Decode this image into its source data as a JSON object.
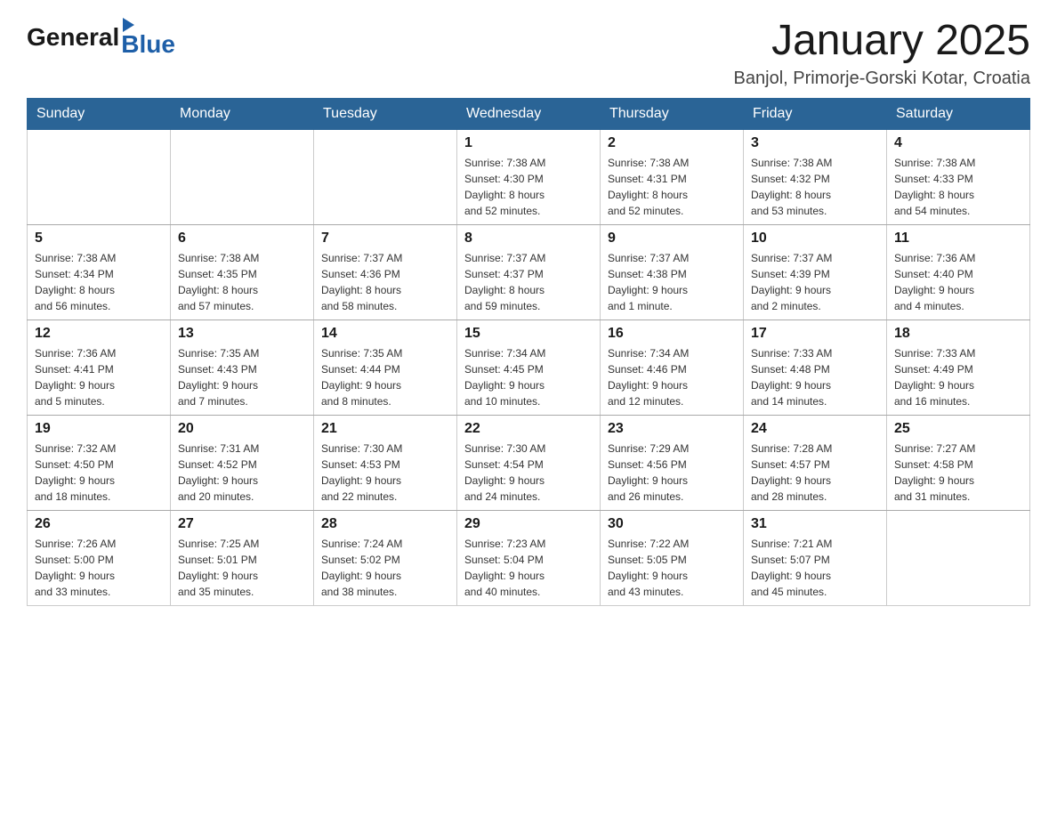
{
  "header": {
    "logo_general": "General",
    "logo_blue": "Blue",
    "title": "January 2025",
    "location": "Banjol, Primorje-Gorski Kotar, Croatia"
  },
  "weekdays": [
    "Sunday",
    "Monday",
    "Tuesday",
    "Wednesday",
    "Thursday",
    "Friday",
    "Saturday"
  ],
  "weeks": [
    [
      {
        "day": "",
        "info": ""
      },
      {
        "day": "",
        "info": ""
      },
      {
        "day": "",
        "info": ""
      },
      {
        "day": "1",
        "info": "Sunrise: 7:38 AM\nSunset: 4:30 PM\nDaylight: 8 hours\nand 52 minutes."
      },
      {
        "day": "2",
        "info": "Sunrise: 7:38 AM\nSunset: 4:31 PM\nDaylight: 8 hours\nand 52 minutes."
      },
      {
        "day": "3",
        "info": "Sunrise: 7:38 AM\nSunset: 4:32 PM\nDaylight: 8 hours\nand 53 minutes."
      },
      {
        "day": "4",
        "info": "Sunrise: 7:38 AM\nSunset: 4:33 PM\nDaylight: 8 hours\nand 54 minutes."
      }
    ],
    [
      {
        "day": "5",
        "info": "Sunrise: 7:38 AM\nSunset: 4:34 PM\nDaylight: 8 hours\nand 56 minutes."
      },
      {
        "day": "6",
        "info": "Sunrise: 7:38 AM\nSunset: 4:35 PM\nDaylight: 8 hours\nand 57 minutes."
      },
      {
        "day": "7",
        "info": "Sunrise: 7:37 AM\nSunset: 4:36 PM\nDaylight: 8 hours\nand 58 minutes."
      },
      {
        "day": "8",
        "info": "Sunrise: 7:37 AM\nSunset: 4:37 PM\nDaylight: 8 hours\nand 59 minutes."
      },
      {
        "day": "9",
        "info": "Sunrise: 7:37 AM\nSunset: 4:38 PM\nDaylight: 9 hours\nand 1 minute."
      },
      {
        "day": "10",
        "info": "Sunrise: 7:37 AM\nSunset: 4:39 PM\nDaylight: 9 hours\nand 2 minutes."
      },
      {
        "day": "11",
        "info": "Sunrise: 7:36 AM\nSunset: 4:40 PM\nDaylight: 9 hours\nand 4 minutes."
      }
    ],
    [
      {
        "day": "12",
        "info": "Sunrise: 7:36 AM\nSunset: 4:41 PM\nDaylight: 9 hours\nand 5 minutes."
      },
      {
        "day": "13",
        "info": "Sunrise: 7:35 AM\nSunset: 4:43 PM\nDaylight: 9 hours\nand 7 minutes."
      },
      {
        "day": "14",
        "info": "Sunrise: 7:35 AM\nSunset: 4:44 PM\nDaylight: 9 hours\nand 8 minutes."
      },
      {
        "day": "15",
        "info": "Sunrise: 7:34 AM\nSunset: 4:45 PM\nDaylight: 9 hours\nand 10 minutes."
      },
      {
        "day": "16",
        "info": "Sunrise: 7:34 AM\nSunset: 4:46 PM\nDaylight: 9 hours\nand 12 minutes."
      },
      {
        "day": "17",
        "info": "Sunrise: 7:33 AM\nSunset: 4:48 PM\nDaylight: 9 hours\nand 14 minutes."
      },
      {
        "day": "18",
        "info": "Sunrise: 7:33 AM\nSunset: 4:49 PM\nDaylight: 9 hours\nand 16 minutes."
      }
    ],
    [
      {
        "day": "19",
        "info": "Sunrise: 7:32 AM\nSunset: 4:50 PM\nDaylight: 9 hours\nand 18 minutes."
      },
      {
        "day": "20",
        "info": "Sunrise: 7:31 AM\nSunset: 4:52 PM\nDaylight: 9 hours\nand 20 minutes."
      },
      {
        "day": "21",
        "info": "Sunrise: 7:30 AM\nSunset: 4:53 PM\nDaylight: 9 hours\nand 22 minutes."
      },
      {
        "day": "22",
        "info": "Sunrise: 7:30 AM\nSunset: 4:54 PM\nDaylight: 9 hours\nand 24 minutes."
      },
      {
        "day": "23",
        "info": "Sunrise: 7:29 AM\nSunset: 4:56 PM\nDaylight: 9 hours\nand 26 minutes."
      },
      {
        "day": "24",
        "info": "Sunrise: 7:28 AM\nSunset: 4:57 PM\nDaylight: 9 hours\nand 28 minutes."
      },
      {
        "day": "25",
        "info": "Sunrise: 7:27 AM\nSunset: 4:58 PM\nDaylight: 9 hours\nand 31 minutes."
      }
    ],
    [
      {
        "day": "26",
        "info": "Sunrise: 7:26 AM\nSunset: 5:00 PM\nDaylight: 9 hours\nand 33 minutes."
      },
      {
        "day": "27",
        "info": "Sunrise: 7:25 AM\nSunset: 5:01 PM\nDaylight: 9 hours\nand 35 minutes."
      },
      {
        "day": "28",
        "info": "Sunrise: 7:24 AM\nSunset: 5:02 PM\nDaylight: 9 hours\nand 38 minutes."
      },
      {
        "day": "29",
        "info": "Sunrise: 7:23 AM\nSunset: 5:04 PM\nDaylight: 9 hours\nand 40 minutes."
      },
      {
        "day": "30",
        "info": "Sunrise: 7:22 AM\nSunset: 5:05 PM\nDaylight: 9 hours\nand 43 minutes."
      },
      {
        "day": "31",
        "info": "Sunrise: 7:21 AM\nSunset: 5:07 PM\nDaylight: 9 hours\nand 45 minutes."
      },
      {
        "day": "",
        "info": ""
      }
    ]
  ]
}
